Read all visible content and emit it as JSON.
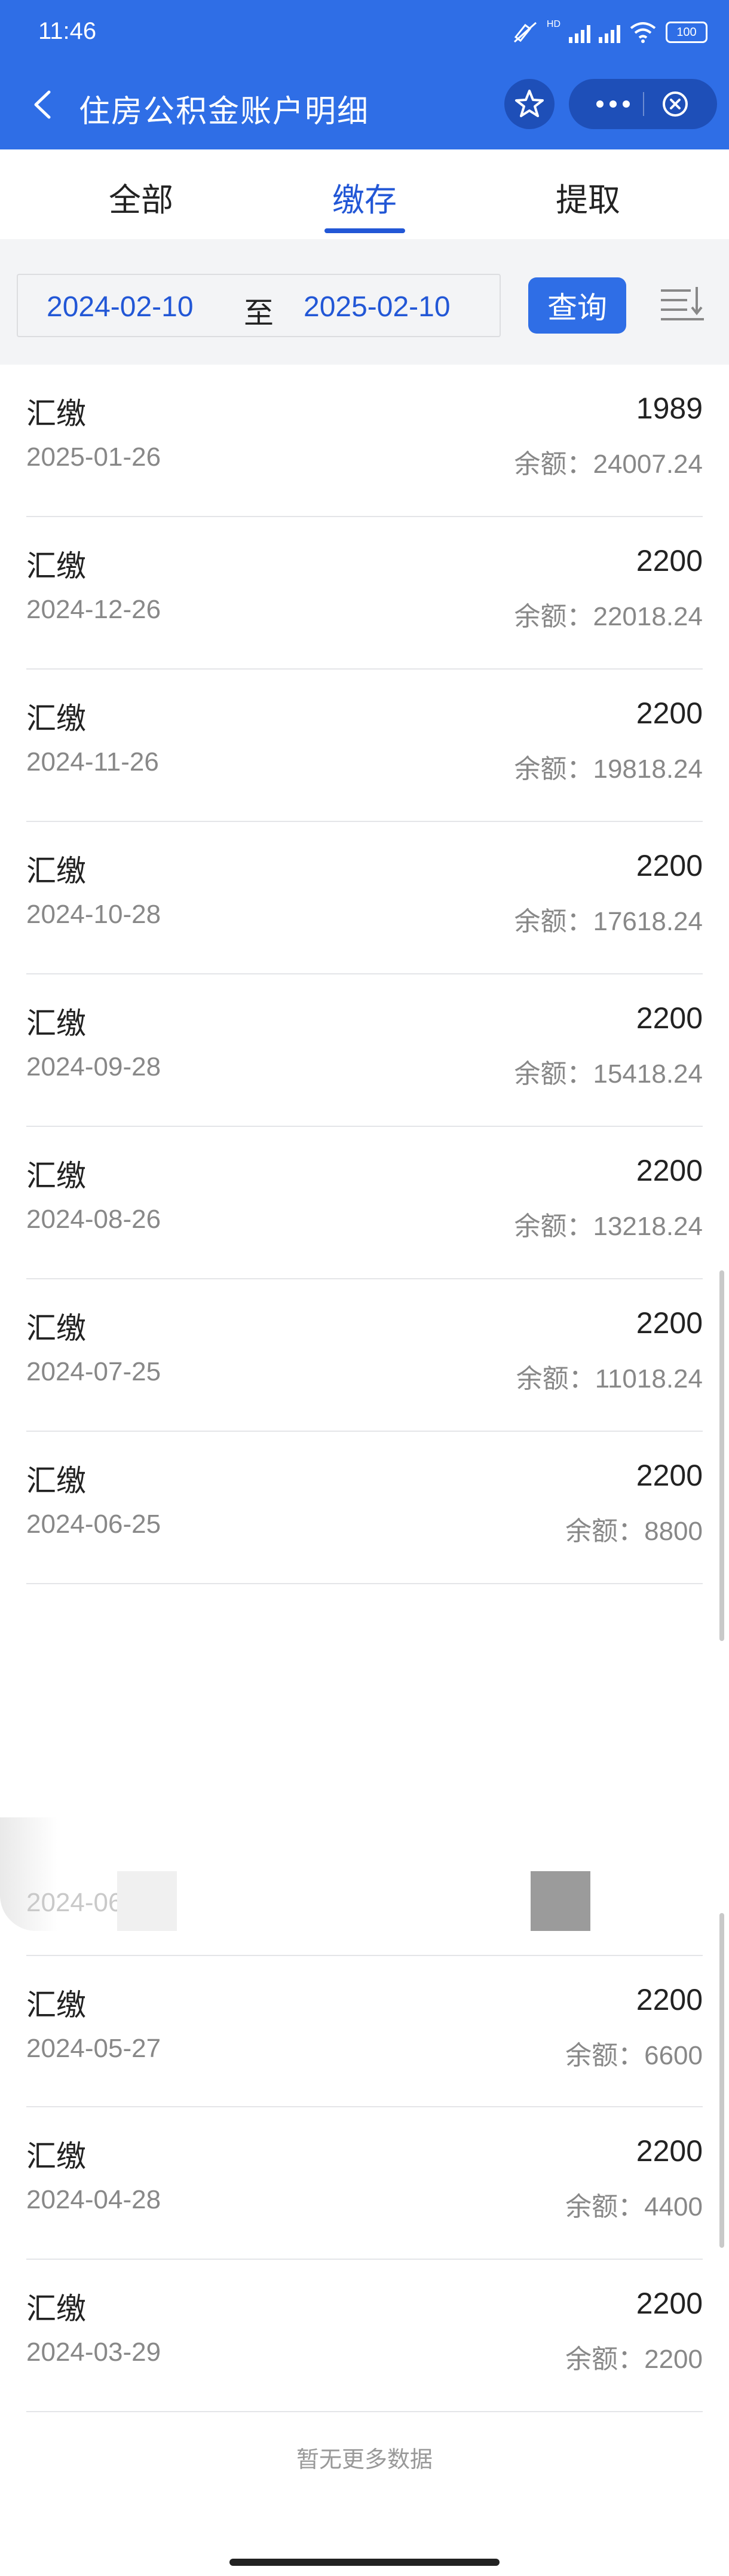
{
  "status_bar": {
    "time": "11:46",
    "network_label": "HD",
    "battery": "100"
  },
  "header": {
    "title": "住房公积金账户明细",
    "back_icon": "chevron-left-icon",
    "favorite_icon": "star-icon",
    "more_icon": "more-dots-icon",
    "close_icon": "close-circle-icon",
    "color": "#2f6ee6"
  },
  "tabs": [
    {
      "label": "全部",
      "active": false
    },
    {
      "label": "缴存",
      "active": true
    },
    {
      "label": "提取",
      "active": false
    }
  ],
  "filter": {
    "start_date": "2024-02-10",
    "separator": "至",
    "end_date": "2025-02-10",
    "query_label": "查询",
    "sort_icon": "sort-icon",
    "accent_color": "#2257d6"
  },
  "balance_label": "余额：",
  "records_top": [
    {
      "type": "汇缴",
      "date": "2025-01-26",
      "amount": "1989",
      "balance": "24007.24"
    },
    {
      "type": "汇缴",
      "date": "2024-12-26",
      "amount": "2200",
      "balance": "22018.24"
    },
    {
      "type": "汇缴",
      "date": "2024-11-26",
      "amount": "2200",
      "balance": "19818.24"
    },
    {
      "type": "汇缴",
      "date": "2024-10-28",
      "amount": "2200",
      "balance": "17618.24"
    },
    {
      "type": "汇缴",
      "date": "2024-09-28",
      "amount": "2200",
      "balance": "15418.24"
    },
    {
      "type": "汇缴",
      "date": "2024-08-26",
      "amount": "2200",
      "balance": "13218.24"
    },
    {
      "type": "汇缴",
      "date": "2024-07-25",
      "amount": "2200",
      "balance": "11018.24"
    },
    {
      "type": "汇缴",
      "date": "2024-06-25",
      "amount": "2200",
      "balance": "8800"
    }
  ],
  "glitch_text": "2024-06-25",
  "records_bottom": [
    {
      "type": "汇缴",
      "date": "2024-05-27",
      "amount": "2200",
      "balance": "6600"
    },
    {
      "type": "汇缴",
      "date": "2024-04-28",
      "amount": "2200",
      "balance": "4400"
    },
    {
      "type": "汇缴",
      "date": "2024-03-29",
      "amount": "2200",
      "balance": "2200"
    }
  ],
  "footer_text": "暂无更多数据"
}
